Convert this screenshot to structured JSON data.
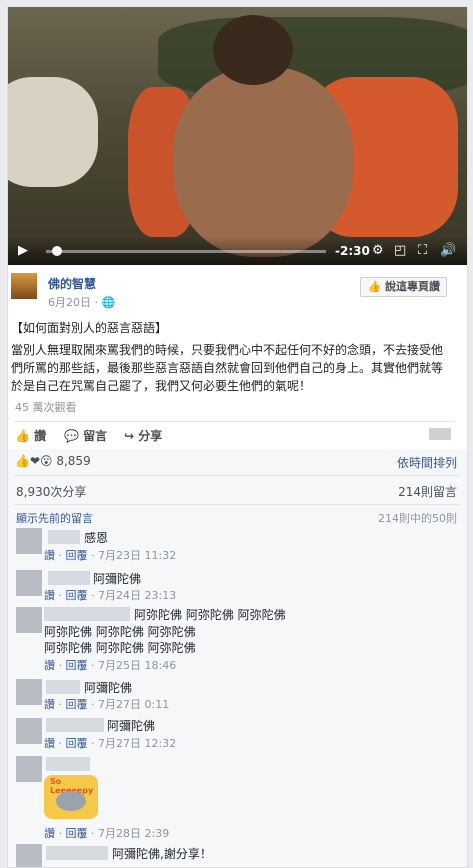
{
  "video": {
    "time_remaining": "-2:30",
    "progress_fraction": 0.04
  },
  "page": {
    "name": "佛的智慧",
    "date": "6月20日",
    "like_page_label": "說這專頁讚"
  },
  "post": {
    "line1": "【如何面對別人的惡言惡語】",
    "line2": "當別人無理取鬧來罵我們的時候，只要我們心中不起任何不好的念頭，不去接受他們所罵的那些話，最後那些惡言惡語自然就會回到他們自己的身上。其實他們就等於是自己在咒罵自己罷了，我們又何必要生他們的氣呢！",
    "views": "45 萬次觀看"
  },
  "actions": {
    "like": "讚",
    "comment": "留言",
    "share": "分享"
  },
  "stats": {
    "reactions": "8,859",
    "sort": "依時間排列",
    "shares": "8,930次分享",
    "comments_total": "214則留言",
    "show_prev": "顯示先前的留言",
    "of_count": "214則中的50則"
  },
  "comments": [
    {
      "text": "感恩",
      "like": "讚",
      "reply": "回覆",
      "time": "7月23日 11:32"
    },
    {
      "text": "阿彌陀佛",
      "like": "讚",
      "reply": "回覆",
      "time": "7月24日 23:13"
    },
    {
      "text": "阿弥陀佛 阿弥陀佛 阿弥陀佛",
      "text2": "阿弥陀佛 阿弥陀佛 阿弥陀佛",
      "text3": "阿弥陀佛 阿弥陀佛 阿弥陀佛",
      "like": "讚",
      "reply": "回覆",
      "time": "7月25日 18:46"
    },
    {
      "text": "阿彌陀佛",
      "like": "讚",
      "reply": "回覆",
      "time": "7月27日 0:11"
    },
    {
      "text": "阿彌陀佛",
      "like": "讚",
      "reply": "回覆",
      "time": "7月27日 12:32"
    },
    {
      "sticker": "So Leeeeepy",
      "like": "讚",
      "reply": "回覆",
      "time": "7月28日 2:39"
    },
    {
      "text": "阿彌陀佛,謝分享！"
    }
  ]
}
